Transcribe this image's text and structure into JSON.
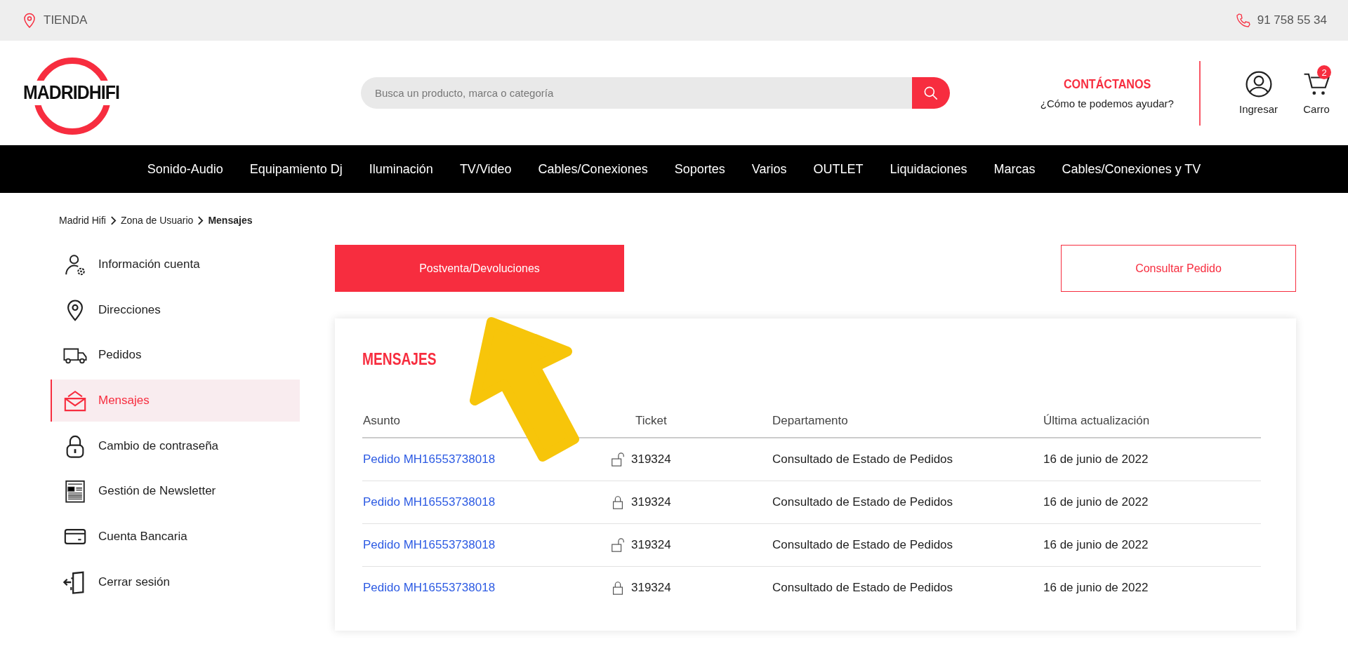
{
  "topbar": {
    "store": "TIENDA",
    "phone": "91 758 55 34"
  },
  "header": {
    "logo": "MADRIDHIFI",
    "search": {
      "placeholder": "Busca un producto, marca o categoría"
    },
    "contact": {
      "title": "CONTÁCTANOS",
      "subtitle": "¿Cómo te podemos ayudar?"
    },
    "account": "Ingresar",
    "cart": {
      "label": "Carro",
      "count": "2"
    }
  },
  "nav": [
    "Sonido-Audio",
    "Equipamiento Dj",
    "Iluminación",
    "TV/Video",
    "Cables/Conexiones",
    "Soportes",
    "Varios",
    "OUTLET",
    "Liquidaciones",
    "Marcas",
    "Cables/Conexiones y TV"
  ],
  "breadcrumb": [
    {
      "label": "Madrid Hifi",
      "current": false
    },
    {
      "label": "Zona de Usuario",
      "current": false
    },
    {
      "label": "Mensajes",
      "current": true
    }
  ],
  "sidebar": {
    "items": [
      {
        "label": "Información cuenta",
        "selected": false
      },
      {
        "label": "Direcciones",
        "selected": false
      },
      {
        "label": "Pedidos",
        "selected": false
      },
      {
        "label": "Mensajes",
        "selected": true
      },
      {
        "label": "Cambio de contraseña",
        "selected": false
      },
      {
        "label": "Gestión de Newsletter",
        "selected": false
      },
      {
        "label": "Cuenta Bancaria",
        "selected": false
      },
      {
        "label": "Cerrar sesión",
        "selected": false
      }
    ]
  },
  "actions": [
    {
      "label": "Postventa/Devoluciones",
      "kind": "primary"
    },
    {
      "label": "Consultar Pedido",
      "kind": "outline"
    }
  ],
  "messages": {
    "title": "MENSAJES",
    "columns": [
      "Asunto",
      "Ticket",
      "Departamento",
      "Última actualización"
    ],
    "rows": [
      {
        "subject": "Pedido MH16553738018",
        "locked": false,
        "ticket": "319324",
        "department": "Consultado de Estado de Pedidos",
        "updated": "16 de junio de 2022"
      },
      {
        "subject": "Pedido MH16553738018",
        "locked": true,
        "ticket": "319324",
        "department": "Consultado de Estado de Pedidos",
        "updated": "16 de junio de 2022"
      },
      {
        "subject": "Pedido MH16553738018",
        "locked": false,
        "ticket": "319324",
        "department": "Consultado de Estado de Pedidos",
        "updated": "16 de junio de 2022"
      },
      {
        "subject": "Pedido MH16553738018",
        "locked": true,
        "ticket": "319324",
        "department": "Consultado de Estado de Pedidos",
        "updated": "16 de junio de 2022"
      }
    ]
  }
}
